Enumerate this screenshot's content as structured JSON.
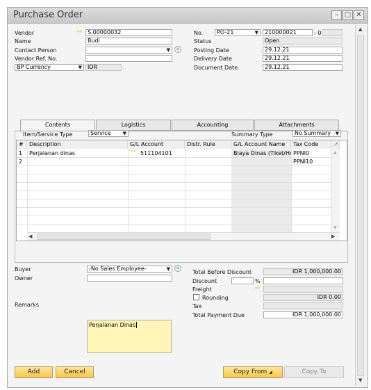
{
  "window": {
    "title": "Purchase Order"
  },
  "header": {
    "vendor_label": "Vendor",
    "vendor_value": "S.00000032",
    "name_label": "Name",
    "name_value": "Budi",
    "contact_label": "Contact Person",
    "contact_value": "",
    "vendor_ref_label": "Vendor Ref. No.",
    "vendor_ref_value": "",
    "bp_currency_label": "BP Currency",
    "bp_currency_value": "IDR",
    "no_label": "No.",
    "no_series": "PO-21",
    "no_value": "210000021",
    "no_suffix": "- 0",
    "status_label": "Status",
    "status_value": "Open",
    "posting_date_label": "Posting Date",
    "posting_date_value": "29.12.21",
    "delivery_date_label": "Delivery Date",
    "delivery_date_value": "29.12.21",
    "document_date_label": "Document Date",
    "document_date_value": "29.12.21"
  },
  "tabs": [
    {
      "label": "Contents"
    },
    {
      "label": "Logistics"
    },
    {
      "label": "Accounting"
    },
    {
      "label": "Attachments"
    }
  ],
  "contents": {
    "item_service_type_label": "Item/Service Type",
    "item_service_type_value": "Service",
    "summary_type_label": "Summary Type",
    "summary_type_value": "No Summary",
    "columns": [
      "#",
      "Description",
      "G/L Account",
      "Distr. Rule",
      "G/L Account Name",
      "Tax Code"
    ],
    "rows": [
      {
        "num": "1",
        "description": "Perjalanan dinas",
        "gl_account": "511104101",
        "distr_rule": "",
        "gl_account_name": "Biaya Dinas (Tiket/Ho",
        "tax_code": "PPNI0"
      },
      {
        "num": "2",
        "description": "",
        "gl_account": "",
        "distr_rule": "",
        "gl_account_name": "",
        "tax_code": "PPNI10"
      }
    ]
  },
  "footer": {
    "buyer_label": "Buyer",
    "buyer_value": "-No Sales Employee-",
    "owner_label": "Owner",
    "owner_value": "",
    "remarks_label": "Remarks",
    "remarks_value": "Perjalanan Dinas",
    "total_before_discount_label": "Total Before Discount",
    "total_before_discount_value": "IDR 1,000,000.00",
    "discount_label": "Discount",
    "discount_percent_sign": "%",
    "freight_label": "Freight",
    "rounding_label": "Rounding",
    "rounding_value": "IDR 0.00",
    "tax_label": "Tax",
    "tax_value": "",
    "total_payment_due_label": "Total Payment Due",
    "total_payment_due_value": "IDR 1,000,000.00"
  },
  "buttons": {
    "add": "Add",
    "cancel": "Cancel",
    "copy_from": "Copy From",
    "copy_to": "Copy To"
  },
  "colors": {
    "accent": "#f6c64b",
    "arrow": "#f2b100"
  }
}
